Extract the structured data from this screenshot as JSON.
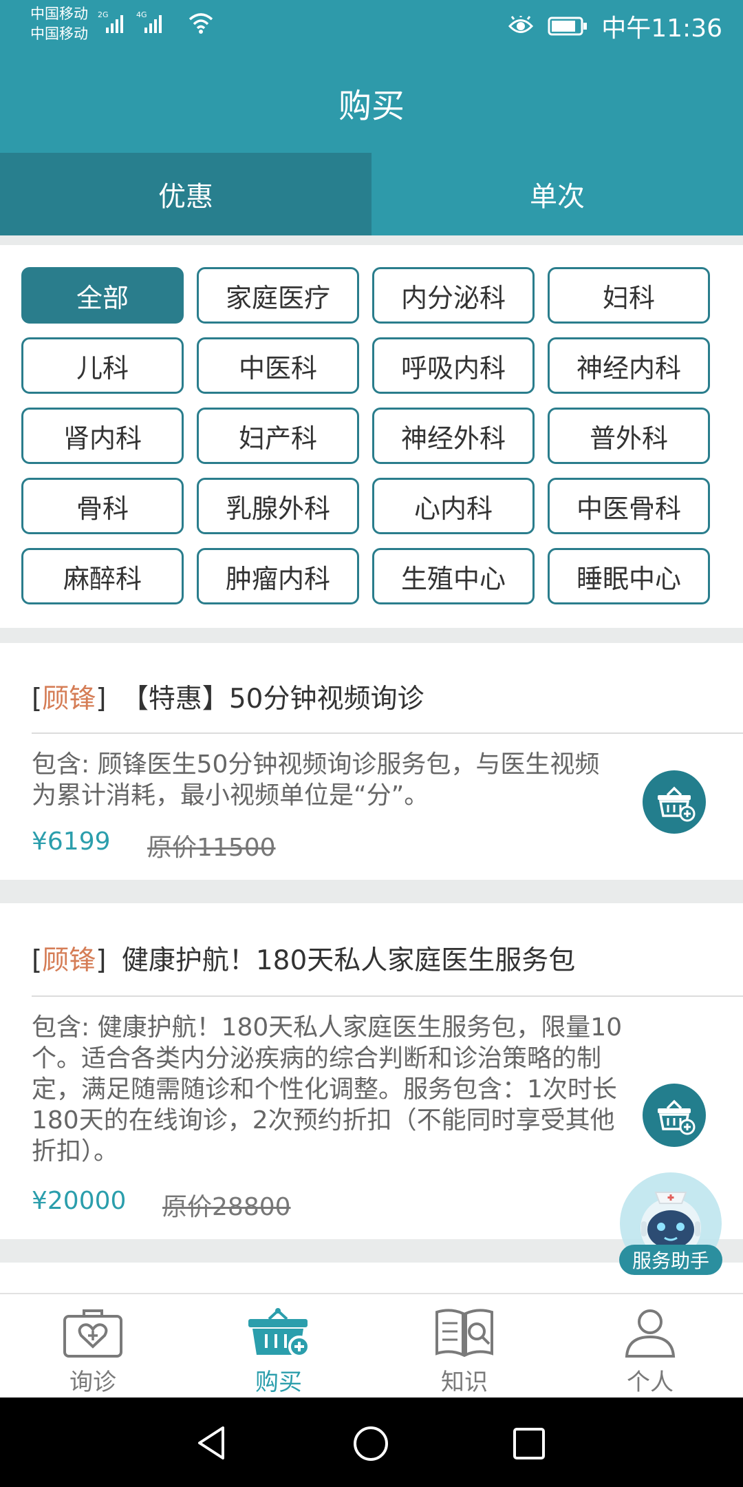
{
  "status_bar": {
    "carrier_1": "中国移动",
    "carrier_2": "中国移动",
    "net_1": "2G",
    "net_2": "4G",
    "time": "中午11:36"
  },
  "header": {
    "title": "购买"
  },
  "tabs": [
    {
      "label": "优惠",
      "active": true
    },
    {
      "label": "单次",
      "active": false
    }
  ],
  "categories": [
    "全部",
    "家庭医疗",
    "内分泌科",
    "妇科",
    "儿科",
    "中医科",
    "呼吸内科",
    "神经内科",
    "肾内科",
    "妇产科",
    "神经外科",
    "普外科",
    "骨科",
    "乳腺外科",
    "心内科",
    "中医骨科",
    "麻醉科",
    "肿瘤内科",
    "生殖中心",
    "睡眠中心"
  ],
  "selected_category": "全部",
  "products": [
    {
      "bracket_open": "[",
      "doctor": "顾锋",
      "bracket_close": "]",
      "title": "【特惠】50分钟视频询诊",
      "description": "包含: 顾锋医生50分钟视频询诊服务包，与医生视频为累计消耗，最小视频单位是“分”。",
      "price": "¥6199",
      "original_label": "原价",
      "original_price": "11500"
    },
    {
      "bracket_open": "[",
      "doctor": "顾锋",
      "bracket_close": "]",
      "title": "健康护航！180天私人家庭医生服务包",
      "description": "包含: 健康护航！180天私人家庭医生服务包，限量10个。适合各类内分泌疾病的综合判断和诊治策略的制定，满足随需随诊和个性化调整。服务包含：1次时长180天的在线询诊，2次预约折扣（不能同时享受其他折扣）。",
      "price": "¥20000",
      "original_label": "原价",
      "original_price": "28800"
    }
  ],
  "assistant": {
    "label": "服务助手"
  },
  "bottom_nav": [
    {
      "label": "询诊",
      "active": false
    },
    {
      "label": "购买",
      "active": true
    },
    {
      "label": "知识",
      "active": false
    },
    {
      "label": "个人",
      "active": false
    }
  ],
  "colors": {
    "primary": "#2e9aaa",
    "tab_active": "#287f8e",
    "category_border": "#2a7d8c",
    "doctor_name": "#d57d56",
    "price": "#2b9eac",
    "nav_active": "#2b9eac",
    "nav_inactive": "#7a7a7a"
  }
}
